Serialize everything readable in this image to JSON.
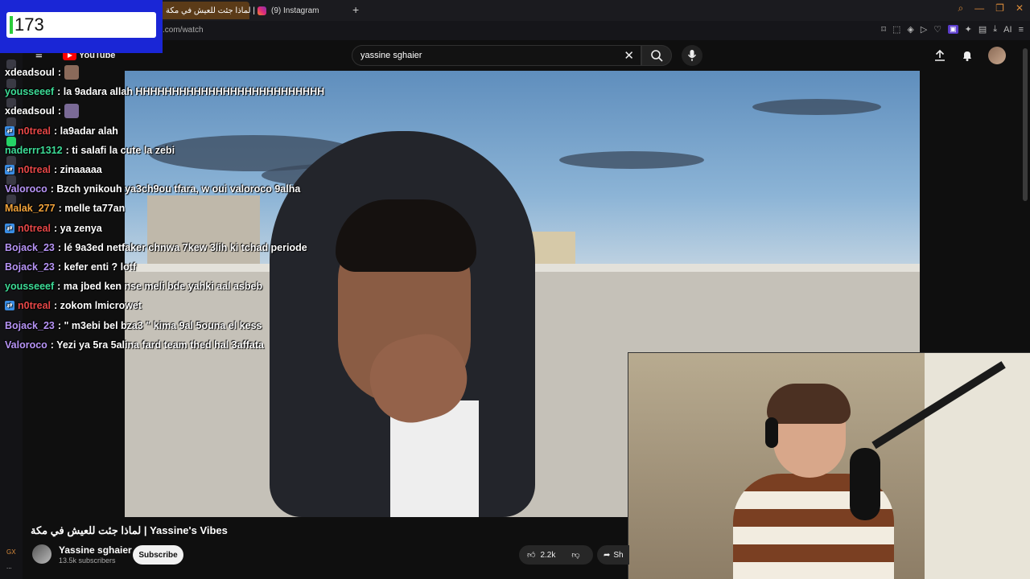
{
  "browser": {
    "tabs": [
      {
        "label": "لماذا جئت للعيش في مكة |",
        "active": true
      },
      {
        "label": "(9) Instagram",
        "active": false
      }
    ],
    "url": ".com/watch"
  },
  "counter": {
    "value": "173"
  },
  "youtube": {
    "logo_text": "YouTube",
    "search_value": "yassine sghaier",
    "video_title": "لماذا جئت للعيش في مكة | Yassine's Vibes",
    "channel_name": "Yassine sghaier",
    "subscribers": "13.5k subscribers",
    "subscribe_label": "Subscribe",
    "likes": "2.2k",
    "share_label": "Sh"
  },
  "chat": [
    {
      "user": "xdeadsoul",
      "color": "#ffffff",
      "msg": ":",
      "emote": true,
      "badge": false
    },
    {
      "user": "yousseeef",
      "color": "#3ddc97",
      "msg": ": la 9adara allah HHHHHHHHHHHHHHHHHHHHHHHHHH",
      "emote": false,
      "badge": false
    },
    {
      "user": "xdeadsoul",
      "color": "#ffffff",
      "msg": ":",
      "emote": true,
      "badge": false
    },
    {
      "user": "n0treal",
      "color": "#e64747",
      "msg": ": la9adar alah",
      "emote": false,
      "badge": true
    },
    {
      "user": "naderrr1312",
      "color": "#3ddc97",
      "msg": ": ti salafi la cute la zebi",
      "emote": false,
      "badge": false
    },
    {
      "user": "n0treal",
      "color": "#e64747",
      "msg": ": zinaaaaa",
      "emote": false,
      "badge": true
    },
    {
      "user": "Valoroco",
      "color": "#b794f6",
      "msg": ": Bzch ynikouh ya3ch9ou tfara, w oui valoroco 9alha",
      "emote": false,
      "badge": false
    },
    {
      "user": "Malak_277",
      "color": "#f2a33a",
      "msg": ": melle ta77an",
      "emote": false,
      "badge": false
    },
    {
      "user": "n0treal",
      "color": "#e64747",
      "msg": ": ya zenya",
      "emote": false,
      "badge": true
    },
    {
      "user": "Bojack_23",
      "color": "#b794f6",
      "msg": ": lé 9a3ed netfaker chnwa 7kew 3lih ki tchad periode",
      "emote": false,
      "badge": false
    },
    {
      "user": "Bojack_23",
      "color": "#b794f6",
      "msg": ": kefer enti ? lotf",
      "emote": false,
      "badge": false
    },
    {
      "user": "yousseeef",
      "color": "#3ddc97",
      "msg": ": ma jbed ken nse meli bde yahki aal asbeb",
      "emote": false,
      "badge": false
    },
    {
      "user": "n0treal",
      "color": "#e64747",
      "msg": ": zokom lmicrowet",
      "emote": false,
      "badge": true
    },
    {
      "user": "Bojack_23",
      "color": "#b794f6",
      "msg": ": \" m3ebi bel bza3 \" kima 9al 5ouna el kess",
      "emote": false,
      "badge": false
    },
    {
      "user": "Valoroco",
      "color": "#b794f6",
      "msg": ": Yezi ya 5ra 5alina fard team thed hal 3affata",
      "emote": false,
      "badge": false
    }
  ],
  "rail": {
    "gx": "GX",
    "more": "..."
  }
}
